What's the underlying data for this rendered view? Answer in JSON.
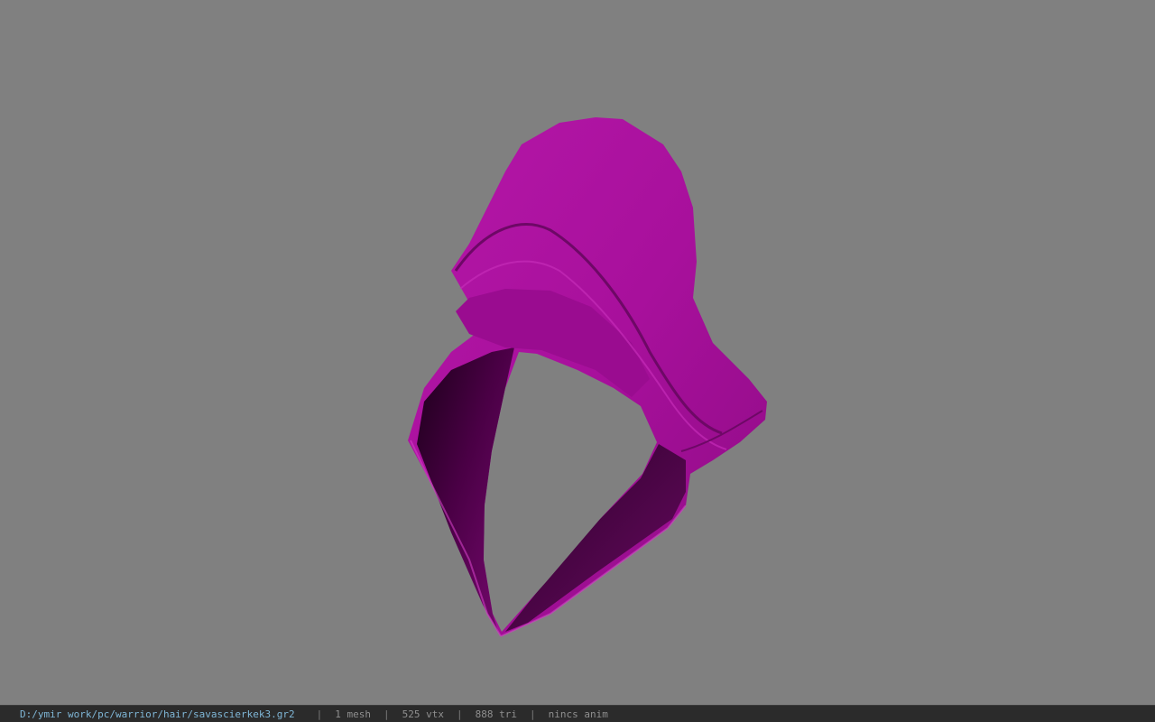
{
  "viewer": {
    "background_color": "#808080",
    "model_color": "#b0129f",
    "model": "hood-mesh"
  },
  "status": {
    "file_path": "D:/ymir work/pc/warrior/hair/savascierkek3.gr2",
    "separator": "|",
    "mesh_count": "1 mesh",
    "vertex_count": "525 vtx",
    "triangle_count": "888 tri",
    "animation": "nincs anim"
  }
}
